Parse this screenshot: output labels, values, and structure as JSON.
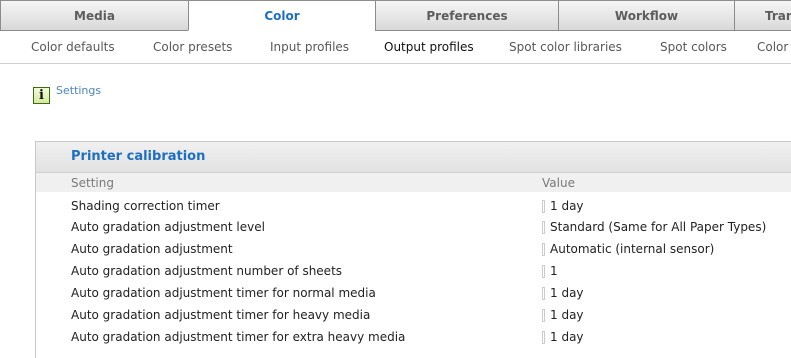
{
  "main_tabs": [
    {
      "label": "Media",
      "active": false
    },
    {
      "label": "Color",
      "active": true
    },
    {
      "label": "Preferences",
      "active": false
    },
    {
      "label": "Workflow",
      "active": false
    },
    {
      "label": "Trans",
      "active": false
    }
  ],
  "sub_tabs": [
    {
      "label": "Color defaults",
      "active": false
    },
    {
      "label": "Color presets",
      "active": false
    },
    {
      "label": "Input profiles",
      "active": false
    },
    {
      "label": "Output profiles",
      "active": true
    },
    {
      "label": "Spot color libraries",
      "active": false
    },
    {
      "label": "Spot colors",
      "active": false
    },
    {
      "label": "Color",
      "active": false
    }
  ],
  "info": {
    "icon": "info-icon",
    "link_label": "Settings"
  },
  "panel": {
    "title": "Printer calibration",
    "columns": {
      "setting": "Setting",
      "value": "Value"
    },
    "rows": [
      {
        "setting": "Shading correction timer",
        "value": "1 day"
      },
      {
        "setting": "Auto gradation adjustment level",
        "value": "Standard (Same for All Paper Types)"
      },
      {
        "setting": "Auto gradation adjustment",
        "value": "Automatic (internal sensor)"
      },
      {
        "setting": "Auto gradation adjustment number of sheets",
        "value": "1"
      },
      {
        "setting": "Auto gradation adjustment timer for normal media",
        "value": "1 day"
      },
      {
        "setting": "Auto gradation adjustment timer for heavy media",
        "value": "1 day"
      },
      {
        "setting": "Auto gradation adjustment timer for extra heavy media",
        "value": "1 day"
      }
    ]
  },
  "colors": {
    "accent": "#1d6fc1",
    "link": "#4a86b8",
    "info_icon": "#d4ea9c"
  }
}
